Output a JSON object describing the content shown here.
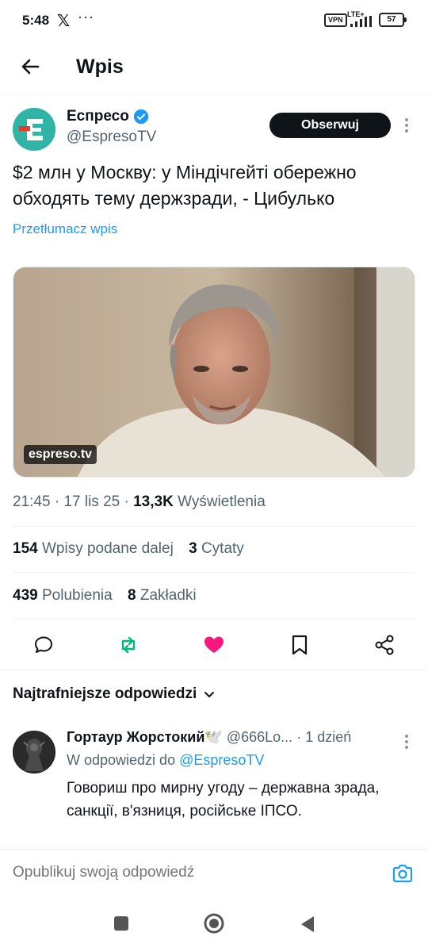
{
  "status_bar": {
    "time": "5:48",
    "x_glyph": "𝕏",
    "dots": "···",
    "vpn": "VPN",
    "network": "LTE+",
    "battery": "57"
  },
  "header": {
    "title": "Wpis",
    "back_icon": "arrow-left-icon"
  },
  "author": {
    "name": "Еспресо",
    "handle": "@EspresoTV",
    "verified": true,
    "follow_label": "Obserwuj"
  },
  "tweet": {
    "text": "$2 млн у Москву: у Міндічгейті обережно обходять тему держзради, - Цибулько",
    "translate_label": "Przetłumacz wpis",
    "media_source": "espreso.tv",
    "time": "21:45",
    "date": "17 lis 25",
    "views_count": "13,3K",
    "views_label": "Wyświetlenia",
    "sep": " · "
  },
  "stats": {
    "reposts_count": "154",
    "reposts_label": "Wpisy podane dalej",
    "quotes_count": "3",
    "quotes_label": "Cytaty",
    "likes_count": "439",
    "likes_label": "Polubienia",
    "bookmarks_count": "8",
    "bookmarks_label": "Zakładki"
  },
  "colors": {
    "accent": "#1d9bf0",
    "repost": "#00ba7c",
    "like": "#f91880",
    "text": "#0f1419",
    "muted": "#536471"
  },
  "replies": {
    "sort_label": "Najtrafniejsze odpowiedzi",
    "items": [
      {
        "name": "Гортаур Жорстокий🕊️",
        "handle": "@666Lo...",
        "time": "· 1 dzień",
        "reply_to_prefix": "W odpowiedzi do",
        "reply_to_handle": "@EspresoTV",
        "text": "Говориш про мирну угоду – державна зрада, санкції, в'язниця, російське ІПСО."
      }
    ]
  },
  "composer": {
    "placeholder": "Opublikuj swoją odpowiedź"
  }
}
